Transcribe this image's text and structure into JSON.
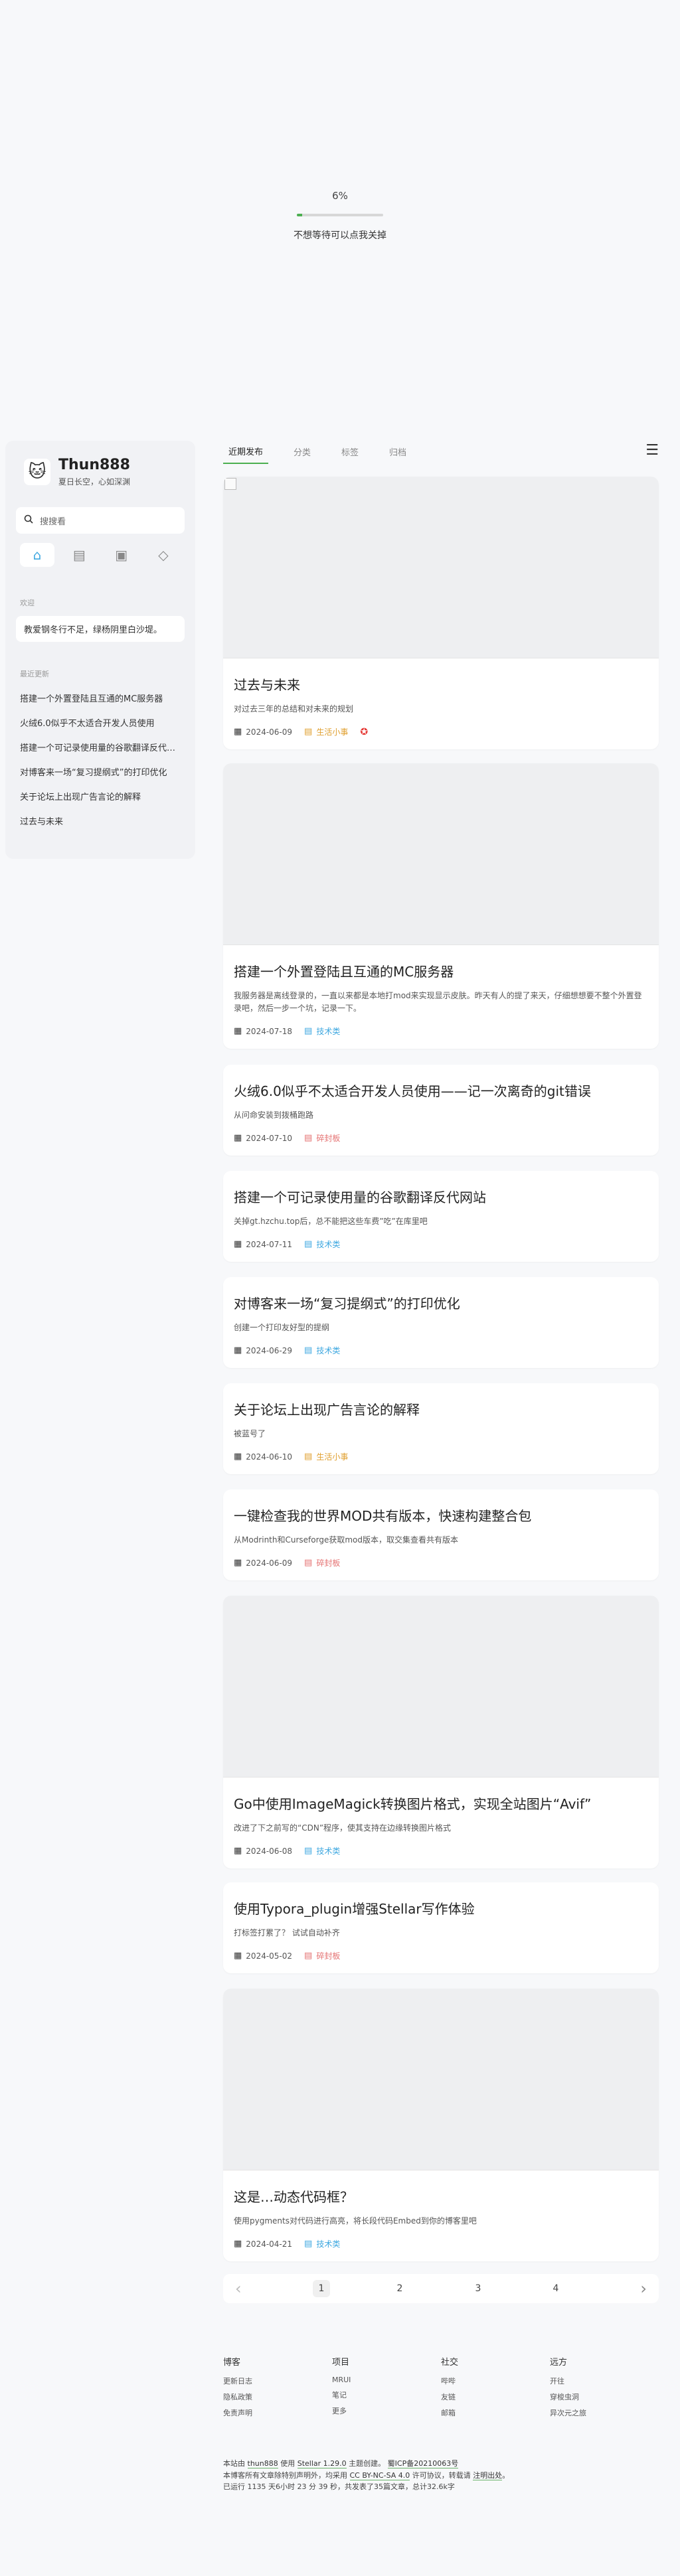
{
  "loading": {
    "percent_text": "6%",
    "progress": 0.06,
    "hint": "不想等待可以点我关掉"
  },
  "sidebar": {
    "title": "Thun888",
    "subtitle": "夏日长空，心如深渊",
    "search_placeholder": "搜搜看",
    "nav_icons": [
      "home-icon",
      "blog-icon",
      "chat-icon",
      "gallery-icon"
    ],
    "notice_label": "欢迎",
    "notice": "教爱钢冬行不足，绿杨阴里白沙堤。",
    "recent_label": "最近更新",
    "recent": [
      "搭建一个外置登陆且互通的MC服务器",
      "火绒6.0似乎不太适合开发人员使用",
      "搭建一个可记录使用量的谷歌翻译反代网站",
      "对博客来一场“复习提纲式”的打印优化",
      "关于论坛上出现广告言论的解释",
      "过去与未来"
    ]
  },
  "tabs": [
    "近期发布",
    "分类",
    "标签",
    "归档"
  ],
  "posts": [
    {
      "title": "过去与未来",
      "excerpt": "对过去三年的总结和对未来的规划",
      "date": "2024-06-09",
      "category": "生活小事",
      "cat_color": "#e0a030"
    },
    {
      "title": "搭建一个外置登陆且互通的MC服务器",
      "excerpt": "我服务器是离线登录的，一直以来都是本地打mod来实现显示皮肤。昨天有人的提了来天，仔细想想要不整个外置登录吧，然后一步一个坑，记录一下。",
      "date": "2024-07-18",
      "category": "技术类",
      "cat_color": "#3fa8e0"
    },
    {
      "title": "火绒6.0似乎不太适合开发人员使用——记一次离奇的git错误",
      "excerpt": "从问命安装到拨桶跑路",
      "date": "2024-07-10",
      "category": "碎封板",
      "cat_color": "#e57373"
    },
    {
      "title": "搭建一个可记录使用量的谷歌翻译反代网站",
      "excerpt": "关掉gt.hzchu.top后，总不能把这些车费”吃”在库里吧",
      "date": "2024-07-11",
      "category": "技术类",
      "cat_color": "#3fa8e0"
    },
    {
      "title": "对博客来一场“复习提纲式”的打印优化",
      "excerpt": "创建一个打印友好型的提纲",
      "date": "2024-06-29",
      "category": "技术类",
      "cat_color": "#3fa8e0"
    },
    {
      "title": "关于论坛上出现广告言论的解释",
      "excerpt": "被蓝号了",
      "date": "2024-06-10",
      "category": "生活小事",
      "cat_color": "#e0a030"
    },
    {
      "title": "一键检查我的世界MOD共有版本，快速构建整合包",
      "excerpt": "从Modrinth和Curseforge获取mod版本，取交集查看共有版本",
      "date": "2024-06-09",
      "category": "碎封板",
      "cat_color": "#e57373"
    },
    {
      "title": "Go中使用ImageMagick转换图片格式，实现全站图片“Avif”",
      "excerpt": "改进了下之前写的“CDN”程序，使其支持在边缘转换图片格式",
      "date": "2024-06-08",
      "category": "技术类",
      "cat_color": "#3fa8e0"
    },
    {
      "title": "使用Typora_plugin增强Stellar写作体验",
      "excerpt": "打标签打累了？ 试试自动补齐",
      "date": "2024-05-02",
      "category": "碎封板",
      "cat_color": "#e57373"
    },
    {
      "title": "这是…动态代码框？",
      "excerpt": "使用pygments对代码进行高亮，将长段代码Embed到你的博客里吧",
      "date": "2024-04-21",
      "category": "技术类",
      "cat_color": "#3fa8e0"
    }
  ],
  "pagination": {
    "prev": "‹",
    "next": "›",
    "pages": [
      "1",
      "2",
      "3",
      "4"
    ],
    "current": "1"
  },
  "footer": {
    "columns": [
      {
        "title": "博客",
        "items": [
          "更新日志",
          "隐私政策",
          "免责声明"
        ]
      },
      {
        "title": "项目",
        "items": [
          "MRUI",
          "笔记",
          "更多"
        ]
      },
      {
        "title": "社交",
        "items": [
          "哔哔",
          "友链",
          "邮箱"
        ]
      },
      {
        "title": "远方",
        "items": [
          "开往",
          "穿梭虫洞",
          "异次元之旅"
        ]
      }
    ],
    "line1_a": "本站由",
    "line1_b": "thun888",
    "line1_c": "使用",
    "line1_d": "Stellar 1.29.0",
    "line1_e": "主题创建。",
    "line1_f": "蜀ICP备20210063号",
    "line2_a": "本博客所有文章除特别声明外，均采用",
    "line2_b": "CC BY-NC-SA 4.0",
    "line2_c": "许可协议，转载请",
    "line2_d": "注明出处",
    "line2_e": "。",
    "line3": "已运行 1135 天6小时 23 分 39 秒，共发表了35篇文章，总计32.6k字"
  }
}
